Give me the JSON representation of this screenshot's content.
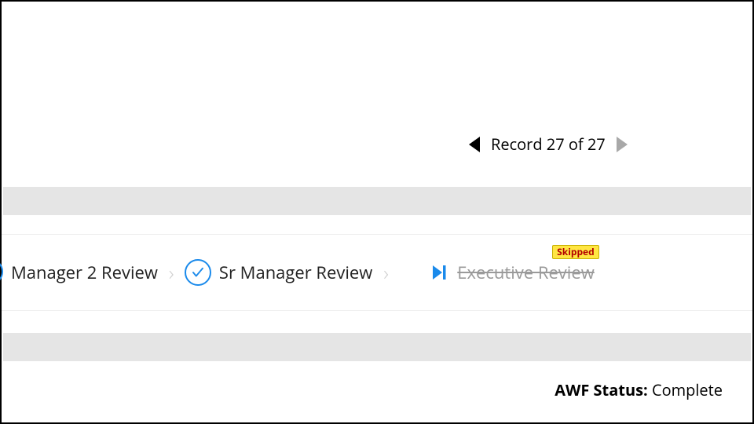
{
  "colors": {
    "accent": "#1a8aeb",
    "muted": "#9a9a9a"
  },
  "record_nav": {
    "text": "Record 27 of 27",
    "current": 27,
    "total": 27,
    "prev_enabled": true,
    "next_enabled": false
  },
  "workflow": {
    "steps": [
      {
        "label": "Manager 2 Review",
        "state": "done",
        "icon": "check-circle"
      },
      {
        "label": "Sr Manager Review",
        "state": "done",
        "icon": "check-circle"
      },
      {
        "label": "Executive Review",
        "state": "skipped",
        "icon": "skip-forward",
        "badge": "Skipped"
      }
    ]
  },
  "status": {
    "label": "AWF Status:",
    "value": "Complete"
  }
}
